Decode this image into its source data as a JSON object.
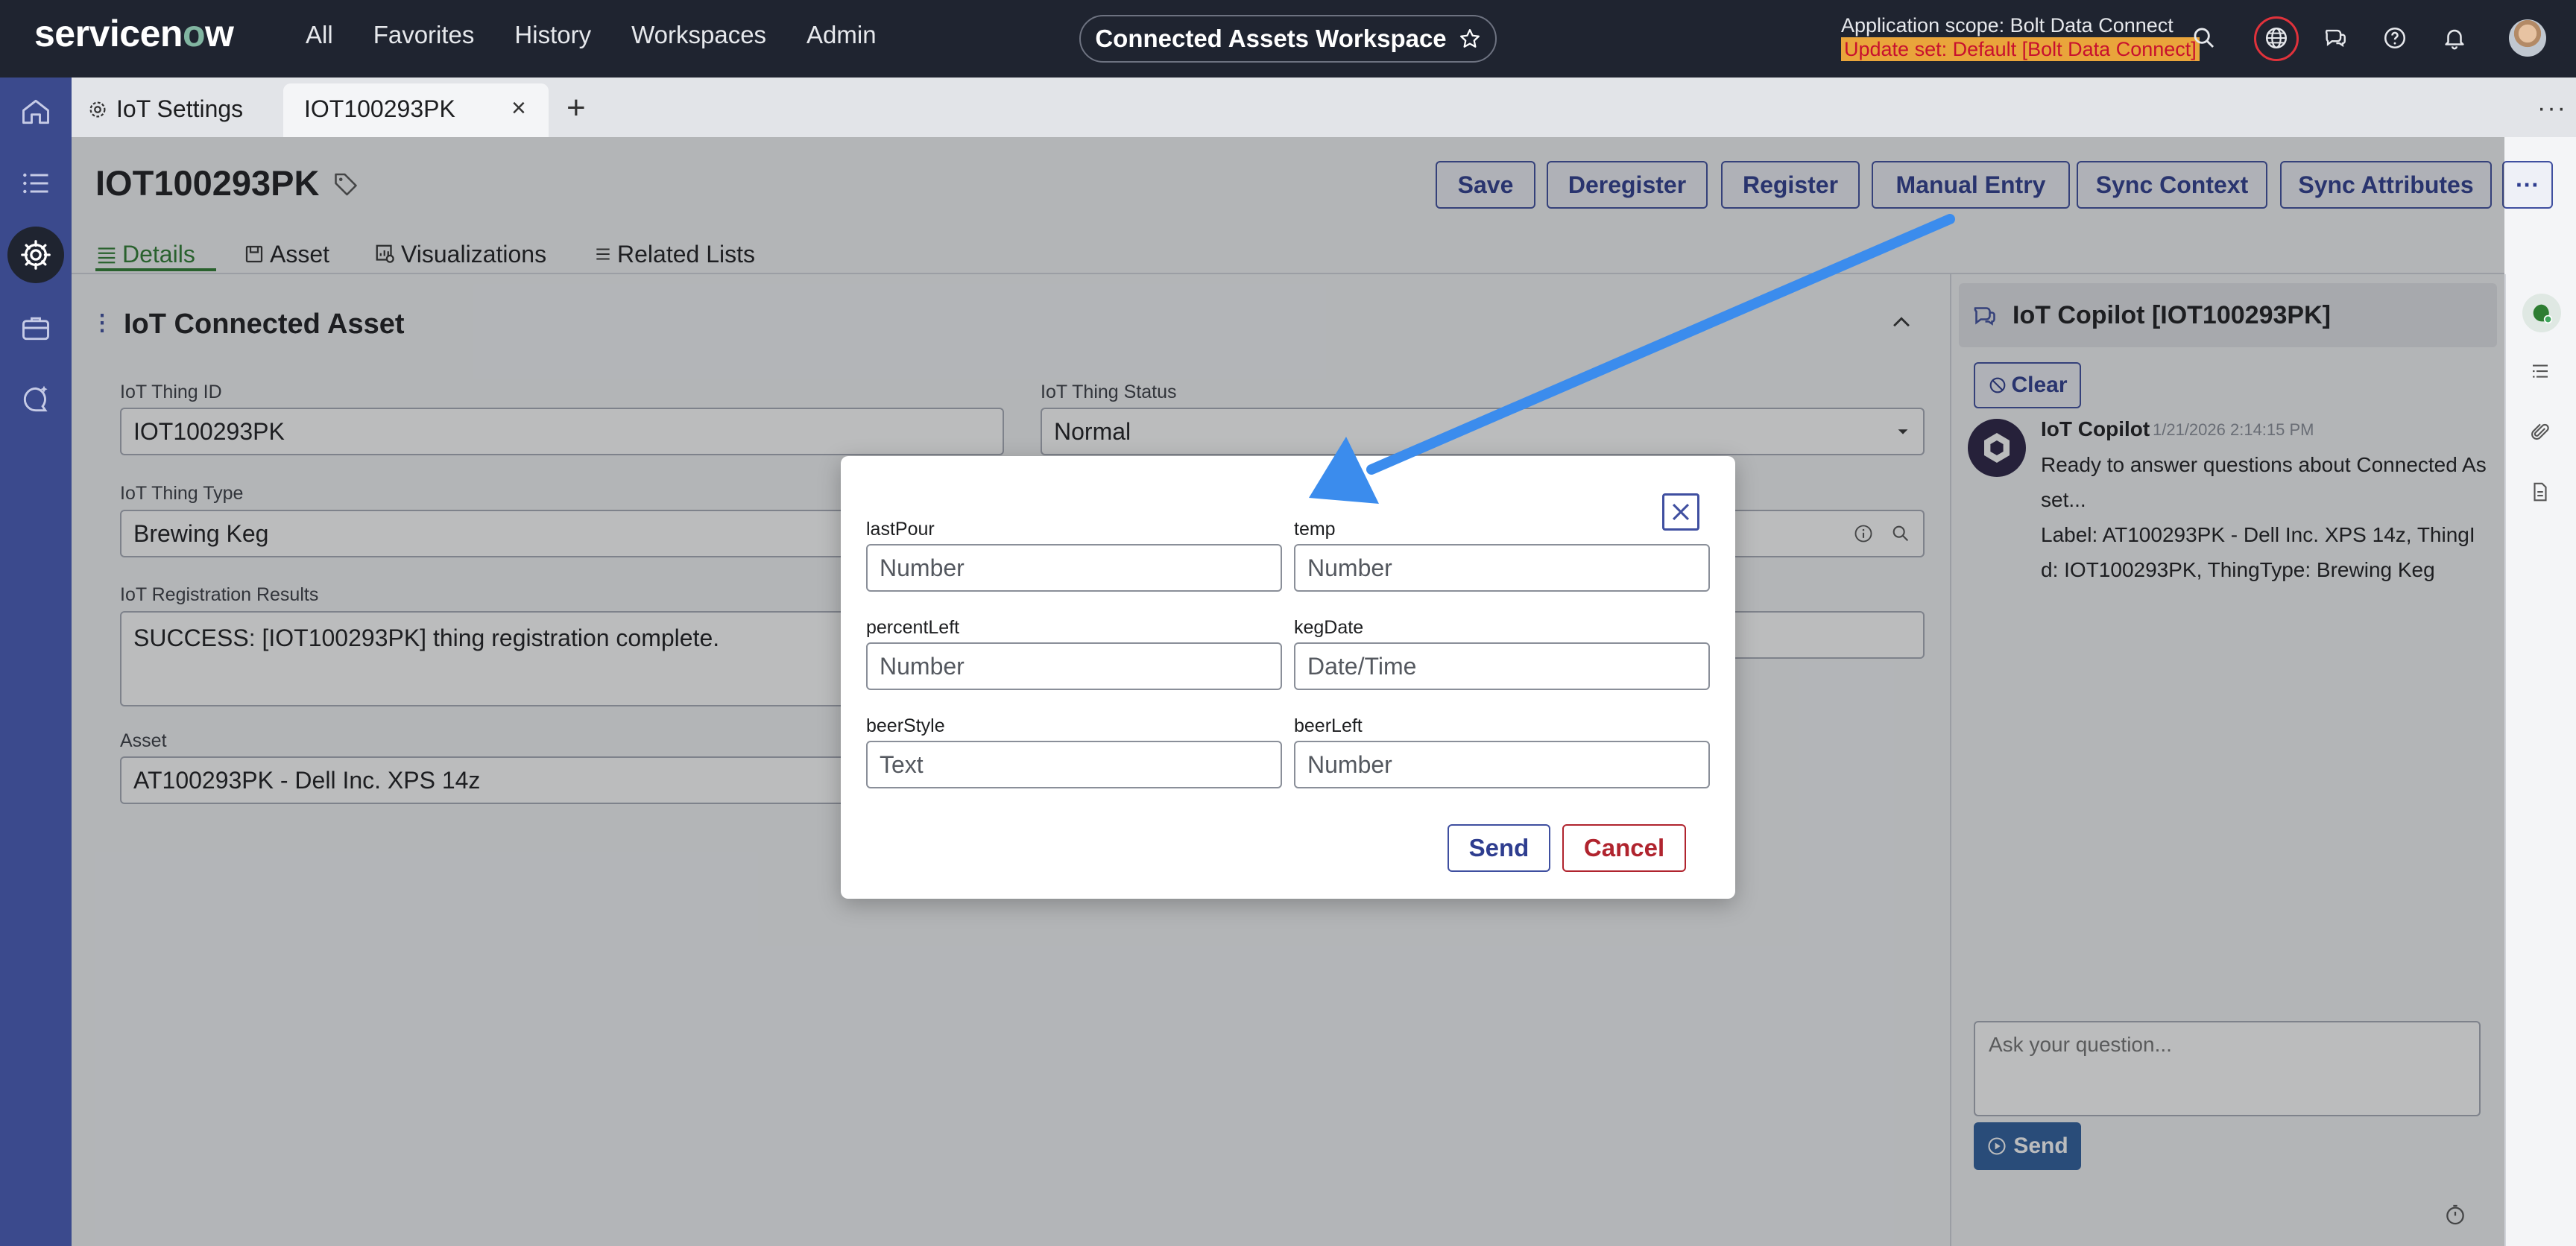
{
  "header": {
    "logo_main": "servicen",
    "logo_o": "o",
    "logo_end": "w",
    "nav": [
      "All",
      "Favorites",
      "History",
      "Workspaces",
      "Admin"
    ],
    "workspace": "Connected Assets Workspace",
    "scope": "Application scope: Bolt Data Connect",
    "update_set": "Update set: Default [Bolt Data Connect]"
  },
  "tabs": {
    "settings": "IoT Settings",
    "record": "IOT100293PK",
    "close": "×",
    "add": "+",
    "more": "···"
  },
  "record": {
    "title": "IOT100293PK",
    "buttons": {
      "save": "Save",
      "deregister": "Deregister",
      "register": "Register",
      "manual_entry": "Manual Entry",
      "sync_context": "Sync Context",
      "sync_attributes": "Sync Attributes",
      "more": "···"
    },
    "subtabs": {
      "details": "Details",
      "asset": "Asset",
      "visualizations": "Visualizations",
      "related_lists": "Related Lists"
    }
  },
  "form": {
    "section_title": "IoT Connected Asset",
    "thing_id_label": "IoT Thing ID",
    "thing_id": "IOT100293PK",
    "thing_status_label": "IoT Thing Status",
    "thing_status": "Normal",
    "thing_type_label": "IoT Thing Type",
    "thing_type": "Brewing Keg",
    "registration_label": "IoT Registration Results",
    "registration": "SUCCESS: [IOT100293PK] thing registration complete.",
    "asset_label": "Asset",
    "asset": "AT100293PK - Dell Inc. XPS 14z"
  },
  "copilot": {
    "title": "IoT Copilot [IOT100293PK]",
    "clear": "Clear",
    "bot_name": "IoT Copilot",
    "timestamp": "1/21/2026 2:14:15 PM",
    "message_1": "Ready to answer questions about Connected Asset...",
    "message_2": "Label: AT100293PK - Dell Inc. XPS 14z, ThingId: IOT100293PK, ThingType: Brewing Keg",
    "ask_placeholder": "Ask your question...",
    "send": "Send"
  },
  "modal": {
    "fields": {
      "lastPour": {
        "label": "lastPour",
        "placeholder": "Number"
      },
      "temp": {
        "label": "temp",
        "placeholder": "Number"
      },
      "percentLeft": {
        "label": "percentLeft",
        "placeholder": "Number"
      },
      "kegDate": {
        "label": "kegDate",
        "placeholder": "Date/Time"
      },
      "beerStyle": {
        "label": "beerStyle",
        "placeholder": "Text"
      },
      "beerLeft": {
        "label": "beerLeft",
        "placeholder": "Number"
      }
    },
    "send": "Send",
    "cancel": "Cancel"
  },
  "colors": {
    "header_bg": "#1f2430",
    "rail_bg": "#3b4a8d",
    "primary": "#3f4fa0",
    "danger": "#b0242e",
    "annotation_arrow": "#3b8ced",
    "update_set_bg": "#e9a53b"
  },
  "icons": {
    "nav_star": "star-icon",
    "search": "search-icon",
    "globe": "globe-icon",
    "chat": "chat-icon",
    "help": "help-icon",
    "bell": "bell-icon",
    "home": "home-icon",
    "list": "list-icon",
    "gear": "gear-icon",
    "briefcase": "briefcase-icon",
    "sparkle": "sparkle-chat-icon"
  }
}
